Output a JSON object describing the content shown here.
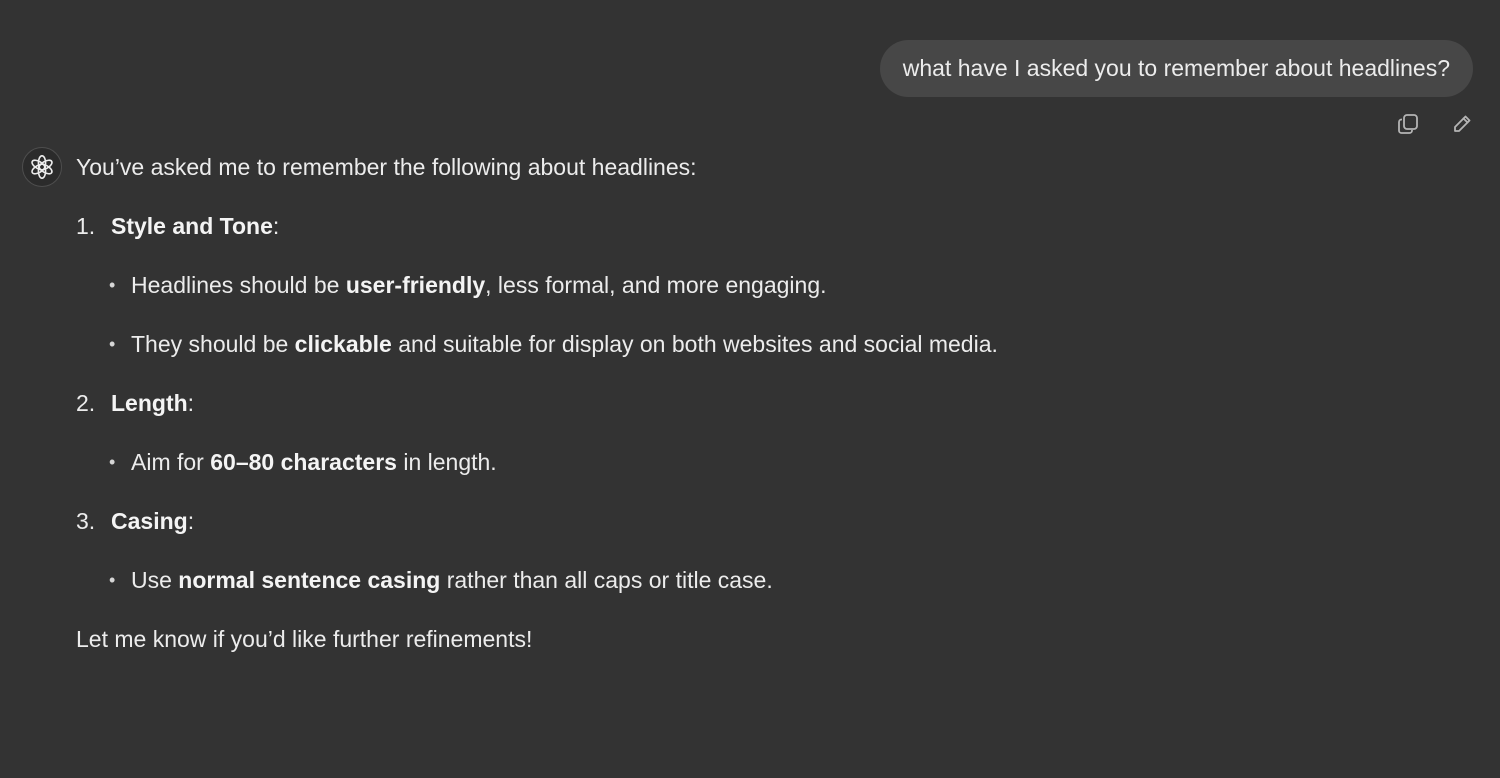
{
  "user_message": {
    "text": "what have I asked you to remember about headlines?",
    "copy_icon": "copy-icon",
    "edit_icon": "pencil-icon"
  },
  "assistant": {
    "avatar_icon": "openai-logo-icon",
    "intro": "You’ve asked me to remember the following about headlines:",
    "sections": [
      {
        "number": "1.",
        "title": "Style and Tone",
        "suffix": ":",
        "bullets": [
          {
            "before": "Headlines should be ",
            "bold": "user-friendly",
            "after": ", less formal, and more engaging."
          },
          {
            "before": "They should be ",
            "bold": "clickable",
            "after": " and suitable for display on both websites and social media."
          }
        ]
      },
      {
        "number": "2.",
        "title": "Length",
        "suffix": ":",
        "bullets": [
          {
            "before": "Aim for ",
            "bold": "60–80 characters",
            "after": " in length."
          }
        ]
      },
      {
        "number": "3.",
        "title": "Casing",
        "suffix": ":",
        "bullets": [
          {
            "before": "Use ",
            "bold": "normal sentence casing",
            "after": " rather than all caps or title case."
          }
        ]
      }
    ],
    "closing": "Let me know if you’d like further refinements!"
  },
  "colors": {
    "background": "#333333",
    "user_bubble": "#474747",
    "text": "#ececec"
  }
}
